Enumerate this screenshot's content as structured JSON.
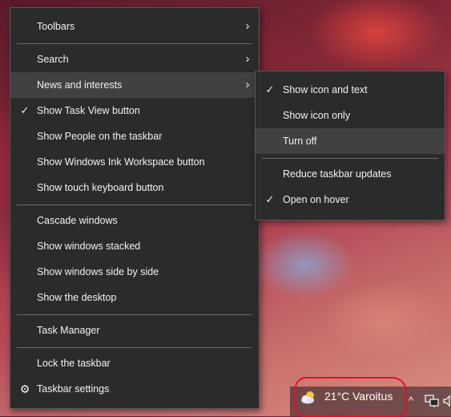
{
  "main_menu": {
    "toolbars": "Toolbars",
    "search": "Search",
    "news_and_interests": "News and interests",
    "show_task_view": "Show Task View button",
    "show_people": "Show People on the taskbar",
    "show_ink_workspace": "Show Windows Ink Workspace button",
    "show_touch_keyboard": "Show touch keyboard button",
    "cascade_windows": "Cascade windows",
    "show_windows_stacked": "Show windows stacked",
    "show_windows_side_by_side": "Show windows side by side",
    "show_desktop": "Show the desktop",
    "task_manager": "Task Manager",
    "lock_taskbar": "Lock the taskbar",
    "taskbar_settings": "Taskbar settings"
  },
  "submenu": {
    "show_icon_and_text": "Show icon and text",
    "show_icon_only": "Show icon only",
    "turn_off": "Turn off",
    "reduce_taskbar_updates": "Reduce taskbar updates",
    "open_on_hover": "Open on hover"
  },
  "taskbar": {
    "weather_temp": "21°C",
    "weather_text": "Varoitus",
    "weather_icon": "partly-cloudy-icon",
    "tray_icons": [
      "chevron-up-icon",
      "network-icon",
      "volume-icon"
    ]
  },
  "glyphs": {
    "check": "✓",
    "arrow": "›",
    "gear": "⚙",
    "chevron_up": "^"
  },
  "colors": {
    "menu_bg": "#2b2b2b",
    "highlight": "#414141",
    "annotation_red": "#e0102a"
  }
}
